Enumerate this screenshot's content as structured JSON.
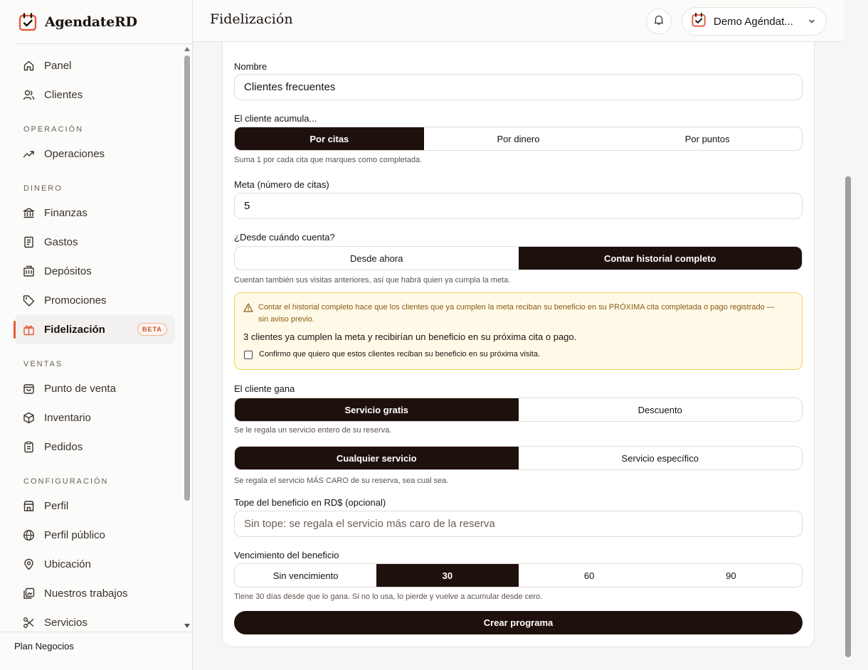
{
  "brand": {
    "name": "AgendateRD",
    "icon": "calendar-check-icon",
    "accent": "#e35a3c"
  },
  "sidebar": {
    "items": [
      {
        "label": "Panel",
        "icon": "home-icon"
      },
      {
        "label": "Clientes",
        "icon": "users-icon"
      }
    ],
    "sections": [
      {
        "title": "OPERACIÓN",
        "items": [
          {
            "label": "Operaciones",
            "icon": "trend-icon"
          }
        ]
      },
      {
        "title": "DINERO",
        "items": [
          {
            "label": "Finanzas",
            "icon": "bank-icon"
          },
          {
            "label": "Gastos",
            "icon": "receipt-icon"
          },
          {
            "label": "Depósitos",
            "icon": "building-icon"
          },
          {
            "label": "Promociones",
            "icon": "tag-icon"
          },
          {
            "label": "Fidelización",
            "icon": "gift-icon",
            "badge": "BETA",
            "active": true
          }
        ]
      },
      {
        "title": "VENTAS",
        "items": [
          {
            "label": "Punto de venta",
            "icon": "cart-icon"
          },
          {
            "label": "Inventario",
            "icon": "box-icon"
          },
          {
            "label": "Pedidos",
            "icon": "clipboard-icon"
          }
        ]
      },
      {
        "title": "CONFIGURACIÓN",
        "items": [
          {
            "label": "Perfil",
            "icon": "store-icon"
          },
          {
            "label": "Perfil público",
            "icon": "globe-icon"
          },
          {
            "label": "Ubicación",
            "icon": "pin-icon"
          },
          {
            "label": "Nuestros trabajos",
            "icon": "gallery-icon"
          },
          {
            "label": "Servicios",
            "icon": "scissors-icon"
          }
        ]
      }
    ],
    "plan": "Plan Negocios"
  },
  "header": {
    "title": "Fidelización",
    "account_name": "Demo Agéndat...",
    "bell_icon": "bell-icon"
  },
  "form": {
    "name_label": "Nombre",
    "name_value": "Clientes frecuentes",
    "accumulates_label": "El cliente acumula...",
    "accumulates_options": [
      "Por citas",
      "Por dinero",
      "Por puntos"
    ],
    "accumulates_selected": "Por citas",
    "accumulates_hint": "Suma 1 por cada cita que marques como completada.",
    "goal_label": "Meta (número de citas)",
    "goal_value": "5",
    "since_label": "¿Desde cuándo cuenta?",
    "since_options": [
      "Desde ahora",
      "Contar historial completo"
    ],
    "since_selected": "Contar historial completo",
    "since_hint": "Cuentan también sus visitas anteriores, así que habrá quien ya cumpla la meta.",
    "warning": {
      "text": "Contar el historial completo hace que los clientes que ya cumplen la meta reciban su beneficio en su PRÓXIMA cita completada o pago registrado — sin aviso previo.",
      "count_text": "3 clientes ya cumplen la meta y recibirían un beneficio en su próxima cita o pago.",
      "confirm_text": "Confirmo que quiero que estos clientes reciban su beneficio en su próxima visita.",
      "confirm_checked": false,
      "border_color": "#f0d060"
    },
    "reward_label": "El cliente gana",
    "reward_options": [
      "Servicio gratis",
      "Descuento"
    ],
    "reward_selected": "Servicio gratis",
    "reward_hint": "Se le regala un servicio entero de su reserva.",
    "service_options": [
      "Cualquier servicio",
      "Servicio específico"
    ],
    "service_selected": "Cualquier servicio",
    "service_hint": "Se regala el servicio MÁS CARO de su reserva, sea cual sea.",
    "cap_label": "Tope del beneficio en RD$ (opcional)",
    "cap_placeholder": "Sin tope: se regala el servicio más caro de la reserva",
    "expiry_label": "Vencimiento del beneficio",
    "expiry_options": [
      "Sin vencimiento",
      "30",
      "60",
      "90"
    ],
    "expiry_selected": "30",
    "expiry_hint": "Tiene 30 días desde que lo gana. Si no lo usa, lo pierde y vuelve a acumular desde cero.",
    "submit_label": "Crear programa"
  }
}
